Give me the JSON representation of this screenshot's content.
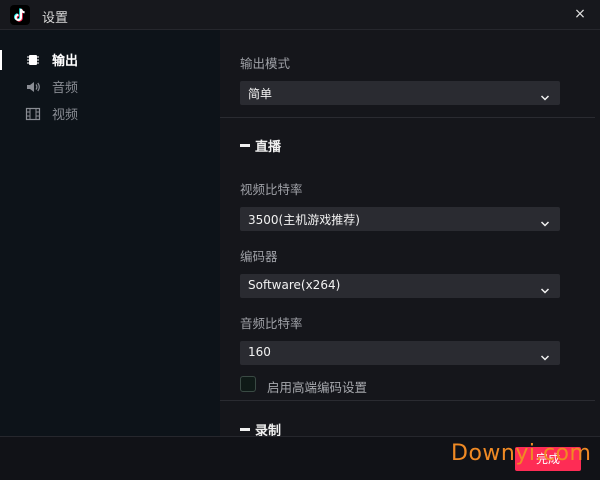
{
  "window": {
    "title": "设置",
    "close_glyph": "×",
    "logo_icon": "tiktok-logo"
  },
  "sidebar": {
    "items": [
      {
        "label": "输出",
        "icon": "chip-icon",
        "active": true
      },
      {
        "label": "音频",
        "icon": "speaker-icon",
        "active": false
      },
      {
        "label": "视频",
        "icon": "film-icon",
        "active": false
      }
    ]
  },
  "main": {
    "output_mode": {
      "label": "输出模式",
      "value": "简单"
    },
    "live_section": {
      "title": "直播"
    },
    "video_bitrate": {
      "label": "视频比特率",
      "value": "3500(主机游戏推荐)"
    },
    "encoder": {
      "label": "编码器",
      "value": "Software(x264)"
    },
    "audio_bitrate": {
      "label": "音频比特率",
      "value": "160"
    },
    "advanced_encoding": {
      "label": "启用高端编码设置",
      "checked": false
    },
    "record_section": {
      "title": "录制"
    }
  },
  "footer": {
    "done_label": "完成"
  },
  "watermark": {
    "text": "Downyi.com"
  },
  "colors": {
    "accent": "#fe2c55",
    "background": "#111217",
    "sidebar": "#0d1319",
    "panel": "#15161b",
    "select_bg": "#2a2b31"
  }
}
